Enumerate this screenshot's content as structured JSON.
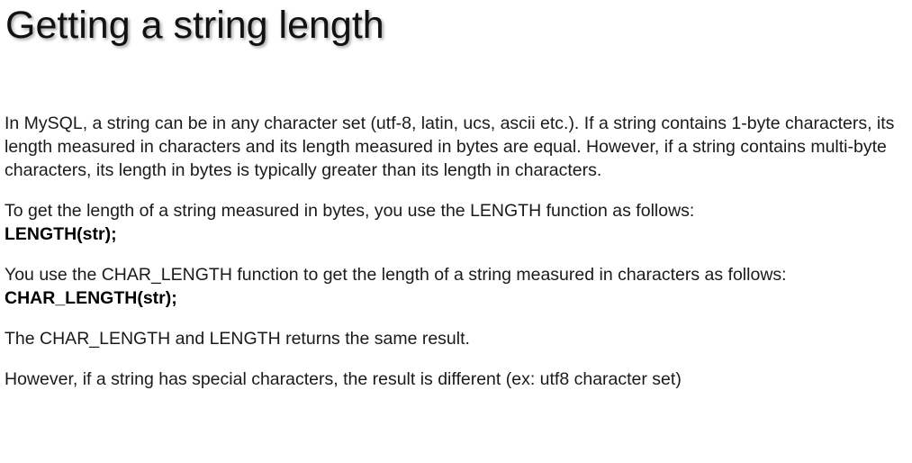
{
  "slide": {
    "title": "Getting a string length",
    "paragraphs": {
      "p1": "In MySQL, a string can be in any character set (utf-8, latin, ucs, ascii etc.). If a string contains 1-byte characters, its length measured in characters and its length measured in bytes are equal. However, if a string contains multi-byte characters, its length in bytes is typically greater than its length in characters.",
      "p2_text": "To get the length of a string measured in bytes, you use the LENGTH  function as follows:",
      "p2_code": "LENGTH(str);",
      "p3_text": "You use the CHAR_LENGTH  function to get the length of a string measured in characters as follows:",
      "p3_code": "CHAR_LENGTH(str);",
      "p4": "The CHAR_LENGTH and LENGTH returns the same result.",
      "p5": "However, if a string has special characters, the result is different (ex: utf8 character set)"
    }
  }
}
